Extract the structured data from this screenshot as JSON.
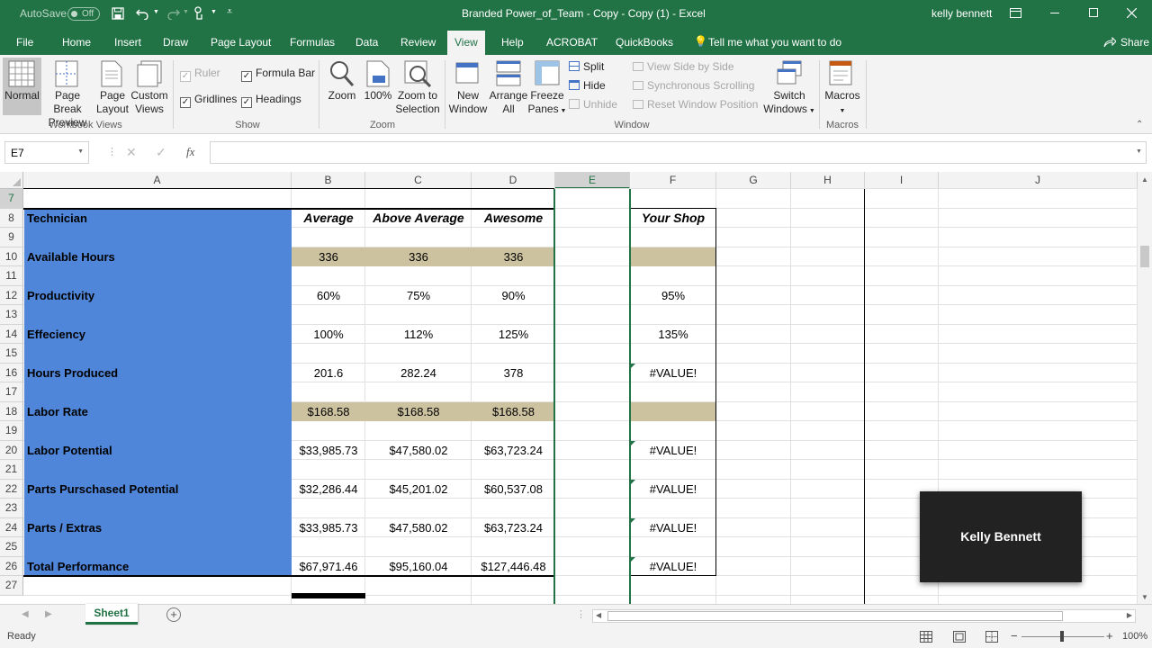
{
  "titlebar": {
    "autosave": "AutoSave",
    "autosave_state": "Off",
    "doc_title": "Branded Power_of_Team - Copy - Copy (1)  -  Excel",
    "user": "kelly bennett"
  },
  "tabs": [
    "File",
    "Home",
    "Insert",
    "Draw",
    "Page Layout",
    "Formulas",
    "Data",
    "Review",
    "View",
    "Help",
    "ACROBAT",
    "QuickBooks"
  ],
  "tell_me": "Tell me what you want to do",
  "share": "Share",
  "ribbon": {
    "views": {
      "normal": "Normal",
      "page_break": [
        "Page Break",
        "Preview"
      ],
      "page_layout": [
        "Page",
        "Layout"
      ],
      "custom": [
        "Custom",
        "Views"
      ],
      "label": "Workbook Views"
    },
    "show": {
      "ruler": "Ruler",
      "formula_bar": "Formula Bar",
      "gridlines": "Gridlines",
      "headings": "Headings",
      "label": "Show"
    },
    "zoom": {
      "zoom": "Zoom",
      "hundred": "100%",
      "zoom_sel": [
        "Zoom to",
        "Selection"
      ],
      "label": "Zoom"
    },
    "window": {
      "new": [
        "New",
        "Window"
      ],
      "arrange": [
        "Arrange",
        "All"
      ],
      "freeze": [
        "Freeze",
        "Panes"
      ],
      "split": "Split",
      "hide": "Hide",
      "unhide": "Unhide",
      "side": "View Side by Side",
      "sync": "Synchronous Scrolling",
      "reset": "Reset Window Position",
      "switch": [
        "Switch",
        "Windows"
      ],
      "label": "Window"
    },
    "macros": {
      "macros": "Macros",
      "label": "Macros"
    }
  },
  "formula": {
    "namebox": "E7",
    "fx": "fx",
    "content": ""
  },
  "columns": [
    "A",
    "B",
    "C",
    "D",
    "E",
    "F",
    "G",
    "H",
    "I",
    "J"
  ],
  "rows": [
    "7",
    "8",
    "9",
    "10",
    "11",
    "12",
    "13",
    "14",
    "15",
    "16",
    "17",
    "18",
    "19",
    "20",
    "21",
    "22",
    "23",
    "24",
    "25",
    "26",
    "27"
  ],
  "table": {
    "header": {
      "a": "Technician",
      "b": "Average",
      "c": "Above Average",
      "d": "Awesome",
      "f": "Your Shop"
    },
    "data": [
      {
        "row": "10",
        "label": "Available Hours",
        "b": "336",
        "c": "336",
        "d": "336",
        "f": ""
      },
      {
        "row": "12",
        "label": "Productivity",
        "b": "60%",
        "c": "75%",
        "d": "90%",
        "f": "95%"
      },
      {
        "row": "14",
        "label": "Effeciency",
        "b": "100%",
        "c": "112%",
        "d": "125%",
        "f": "135%"
      },
      {
        "row": "16",
        "label": "Hours Produced",
        "b": "201.6",
        "c": "282.24",
        "d": "378",
        "f": "#VALUE!"
      },
      {
        "row": "18",
        "label": "Labor Rate",
        "b": "$168.58",
        "c": "$168.58",
        "d": "$168.58",
        "f": ""
      },
      {
        "row": "20",
        "label": "Labor Potential",
        "b": "$33,985.73",
        "c": "$47,580.02",
        "d": "$63,723.24",
        "f": "#VALUE!"
      },
      {
        "row": "22",
        "label": "Parts Purschased Potential",
        "b": "$32,286.44",
        "c": "$45,201.02",
        "d": "$60,537.08",
        "f": "#VALUE!"
      },
      {
        "row": "24",
        "label": "Parts / Extras",
        "b": "$33,985.73",
        "c": "$47,580.02",
        "d": "$63,723.24",
        "f": "#VALUE!"
      },
      {
        "row": "26",
        "label": "Total Performance",
        "b": "$67,971.46",
        "c": "$95,160.04",
        "d": "$127,446.48",
        "f": "#VALUE!"
      }
    ]
  },
  "sheet_tab": "Sheet1",
  "status": {
    "ready": "Ready",
    "zoom": "100%"
  },
  "overlay": "Kelly Bennett",
  "colors": {
    "excel_green": "#217346",
    "label_fill": "#4f86d9",
    "tan_fill": "#cdc29f"
  }
}
